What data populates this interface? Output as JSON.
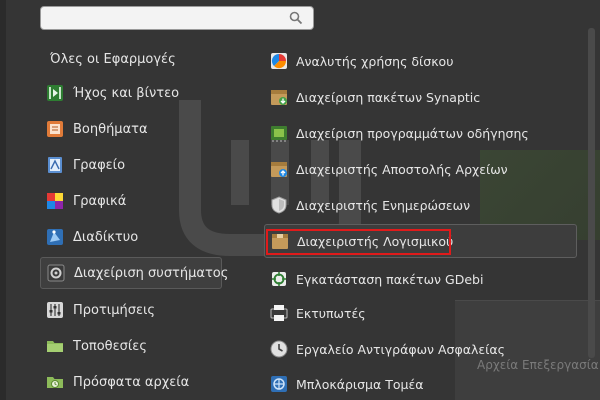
{
  "search": {
    "placeholder": "",
    "value": ""
  },
  "sidebar": {
    "all_apps_label": "Όλες οι Εφαρμογές",
    "categories": [
      {
        "label": "Ήχος και βίντεο",
        "icon": "multimedia-icon"
      },
      {
        "label": "Βοηθήματα",
        "icon": "accessories-icon"
      },
      {
        "label": "Γραφείο",
        "icon": "office-icon"
      },
      {
        "label": "Γραφικά",
        "icon": "graphics-icon"
      },
      {
        "label": "Διαδίκτυο",
        "icon": "internet-icon"
      },
      {
        "label": "Διαχείριση συστήματος",
        "icon": "administration-icon",
        "selected": true
      },
      {
        "label": "Προτιμήσεις",
        "icon": "preferences-icon"
      },
      {
        "label": "Τοποθεσίες",
        "icon": "places-icon"
      },
      {
        "label": "Πρόσφατα αρχεία",
        "icon": "recent-files-icon"
      }
    ]
  },
  "apps": [
    {
      "label": "Αναλυτής χρήσης δίσκου",
      "icon": "disk-usage-icon"
    },
    {
      "label": "Διαχείριση πακέτων Synaptic",
      "icon": "synaptic-icon"
    },
    {
      "label": "Διαχείριση προγραμμάτων οδήγησης",
      "icon": "driver-manager-icon"
    },
    {
      "label": "Διαχειριστής Αποστολής Αρχείων",
      "icon": "upload-manager-icon"
    },
    {
      "label": "Διαχειριστής Ενημερώσεων",
      "icon": "update-manager-shield-icon"
    },
    {
      "label": "Διαχειριστής Λογισμικού",
      "icon": "software-manager-icon",
      "hover": true,
      "highlighted": true
    },
    {
      "label": "Εγκατάσταση πακέτων GDebi",
      "icon": "gdebi-icon"
    },
    {
      "label": "Εκτυπωτές",
      "icon": "printer-icon"
    },
    {
      "label": "Εργαλείο Αντιγράφων Ασφαλείας",
      "icon": "backup-tool-icon"
    },
    {
      "label": "Μπλοκάρισμα Τομέα",
      "icon": "domain-blocker-icon"
    }
  ],
  "background_window": {
    "text": "Αρχεία   Επεξεργασία"
  },
  "colors": {
    "highlight_border": "#e01b1b",
    "menu_bg": "#353535"
  }
}
